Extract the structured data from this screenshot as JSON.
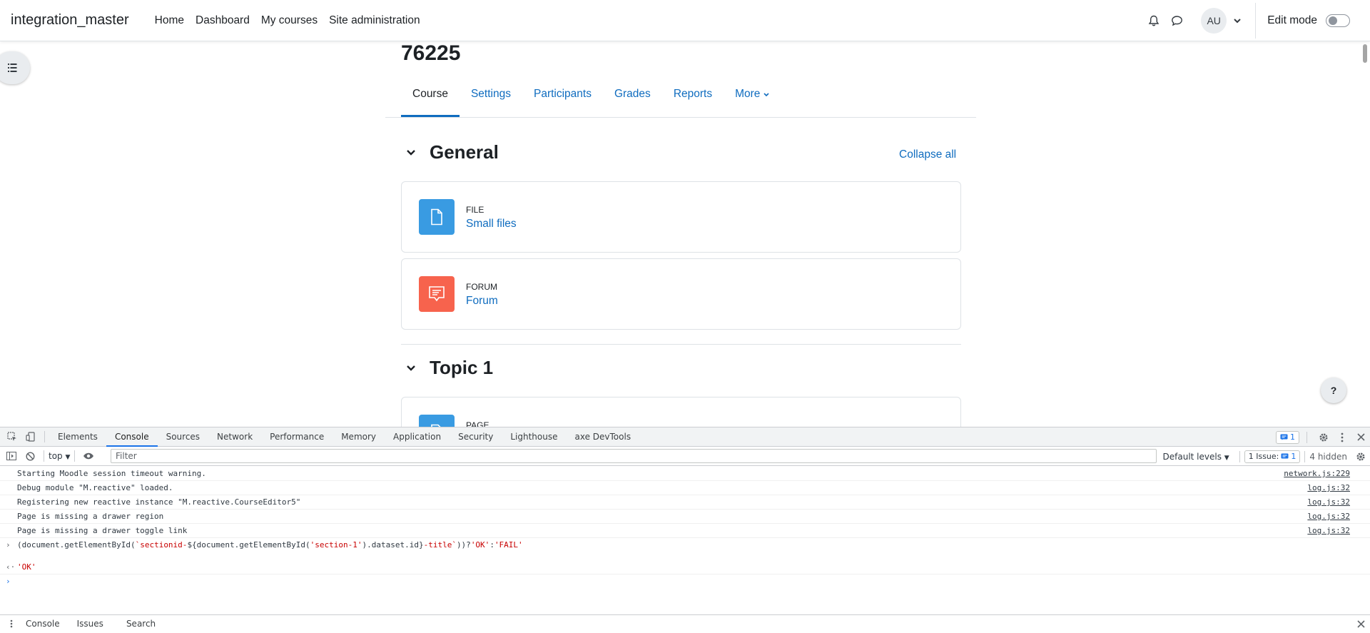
{
  "navbar": {
    "brand": "integration_master",
    "items": [
      "Home",
      "Dashboard",
      "My courses",
      "Site administration"
    ],
    "avatar_initials": "AU",
    "edit_mode_label": "Edit mode"
  },
  "course": {
    "title": "76225",
    "tabs": [
      "Course",
      "Settings",
      "Participants",
      "Grades",
      "Reports",
      "More"
    ],
    "active_tab": "Course",
    "collapse_all": "Collapse all",
    "sections": [
      {
        "title": "General",
        "activities": [
          {
            "type": "FILE",
            "name": "Small files",
            "icon": "file-icon",
            "color": "#399be2"
          },
          {
            "type": "FORUM",
            "name": "Forum",
            "icon": "forum-icon",
            "color": "#f7634d"
          }
        ]
      },
      {
        "title": "Topic 1",
        "activities": [
          {
            "type": "PAGE",
            "name": "",
            "icon": "page-icon",
            "color": "#399be2"
          }
        ]
      }
    ],
    "help_label": "?"
  },
  "devtools": {
    "tabs": [
      "Elements",
      "Console",
      "Sources",
      "Network",
      "Performance",
      "Memory",
      "Application",
      "Security",
      "Lighthouse",
      "axe DevTools"
    ],
    "active_tab": "Console",
    "message_count": "1",
    "context": "top",
    "filter_placeholder": "Filter",
    "levels": "Default levels",
    "issues_label": "1 Issue:",
    "issues_count": "1",
    "hidden": "4 hidden",
    "logs": [
      {
        "text": "Starting Moodle session timeout warning.",
        "source": "network.js:229"
      },
      {
        "text": "Debug module \"M.reactive\" loaded.",
        "source": "log.js:32"
      },
      {
        "text": "Registering new reactive instance \"M.reactive.CourseEditor5\"",
        "source": "log.js:32"
      },
      {
        "text": "Page is missing a drawer region",
        "source": "log.js:32"
      },
      {
        "text": "Page is missing a drawer toggle link",
        "source": "log.js:32"
      }
    ],
    "command": {
      "p1": "(document.getElementById(",
      "s1": "`sectionid-",
      "p2": "${document.getElementById(",
      "s2": "'section-1'",
      "p3": ").dataset.id}",
      "s3": "-title`",
      "p4": "))?",
      "s4": "'OK'",
      "p5": ":",
      "s5": "'FAIL'"
    },
    "result": "'OK'",
    "drawer_tabs": [
      "Console",
      "Issues",
      "Search"
    ]
  }
}
